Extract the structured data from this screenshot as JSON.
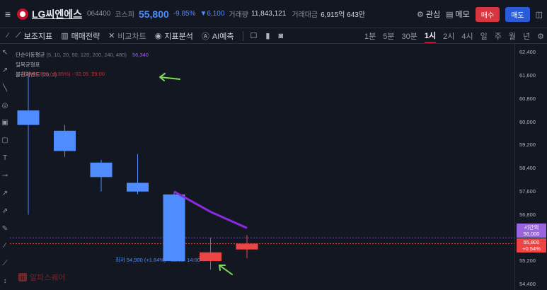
{
  "header": {
    "stock_name": "LG씨엔에스",
    "code": "064400",
    "market": "코스피",
    "price": "55,800",
    "change_pct": "-9.85%",
    "change_abs": "▼6,100",
    "volume_label": "거래량",
    "volume": "11,843,121",
    "amount_label": "거래대금",
    "amount": "6,915억 643만",
    "watch_label": "관심",
    "memo_label": "메모",
    "buy_label": "매수",
    "sell_label": "매도"
  },
  "toolbar": {
    "indicator_label": "보조지표",
    "strategy_label": "매매전략",
    "compare_label": "비교차트",
    "analysis_label": "지표분석",
    "ai_label": "AI예측",
    "intervals": [
      "1분",
      "5분",
      "30분",
      "1시",
      "2시",
      "4시",
      "일",
      "주",
      "월",
      "년"
    ],
    "active_interval": "1시"
  },
  "legend": {
    "ma_name": "단순이동평균",
    "ma_params": "(5, 10, 20, 50, 120, 200, 240, 480)",
    "ma_value": "56,340",
    "ichimoku": "일목균형표",
    "bollinger": "볼린저밴드",
    "bollinger_params": "(20, 2)",
    "high_note": "최고 61,800 (-9.85%) - 02.05. 09:00"
  },
  "low_note": "최저 54,900 (+1.64%) - 02.05. 14:00 →",
  "watermark": "알파스퀘어",
  "axis": {
    "ticks": [
      "62,400",
      "61,600",
      "60,800",
      "60,000",
      "59,200",
      "58,400",
      "57,600",
      "56,800",
      "55,200",
      "54,400"
    ],
    "time_tag_title": "시간외",
    "time_tag_value": "56,000",
    "current_price": "55,800",
    "current_change": "+0.54%"
  },
  "colors": {
    "up": "#ef4444",
    "down": "#4e8cff",
    "ma": "#8a2be2",
    "arrow": "#7ed957",
    "time_tag": "#9a63e0"
  },
  "chart_data": {
    "type": "candlestick",
    "ylim": [
      54200,
      62700
    ],
    "candles": [
      {
        "open": 60400,
        "close": 59900,
        "high": 61700,
        "low": 56800
      },
      {
        "open": 59700,
        "close": 59000,
        "high": 59900,
        "low": 58800
      },
      {
        "open": 58600,
        "close": 58100,
        "high": 58700,
        "low": 57600
      },
      {
        "open": 57900,
        "close": 57600,
        "high": 58900,
        "low": 57500
      },
      {
        "open": 57500,
        "close": 55200,
        "high": 57600,
        "low": 55200
      },
      {
        "open": 55200,
        "close": 55500,
        "high": 56000,
        "low": 54900
      },
      {
        "open": 55600,
        "close": 55800,
        "high": 56100,
        "low": 55300
      }
    ],
    "ma_line": [
      57600,
      56900,
      56340
    ],
    "ma_line_start_index": 4,
    "dashed_levels": [
      56000,
      55800
    ],
    "ticks": [
      62400,
      61600,
      60800,
      60000,
      59200,
      58400,
      57600,
      56800,
      55200,
      54400
    ]
  }
}
